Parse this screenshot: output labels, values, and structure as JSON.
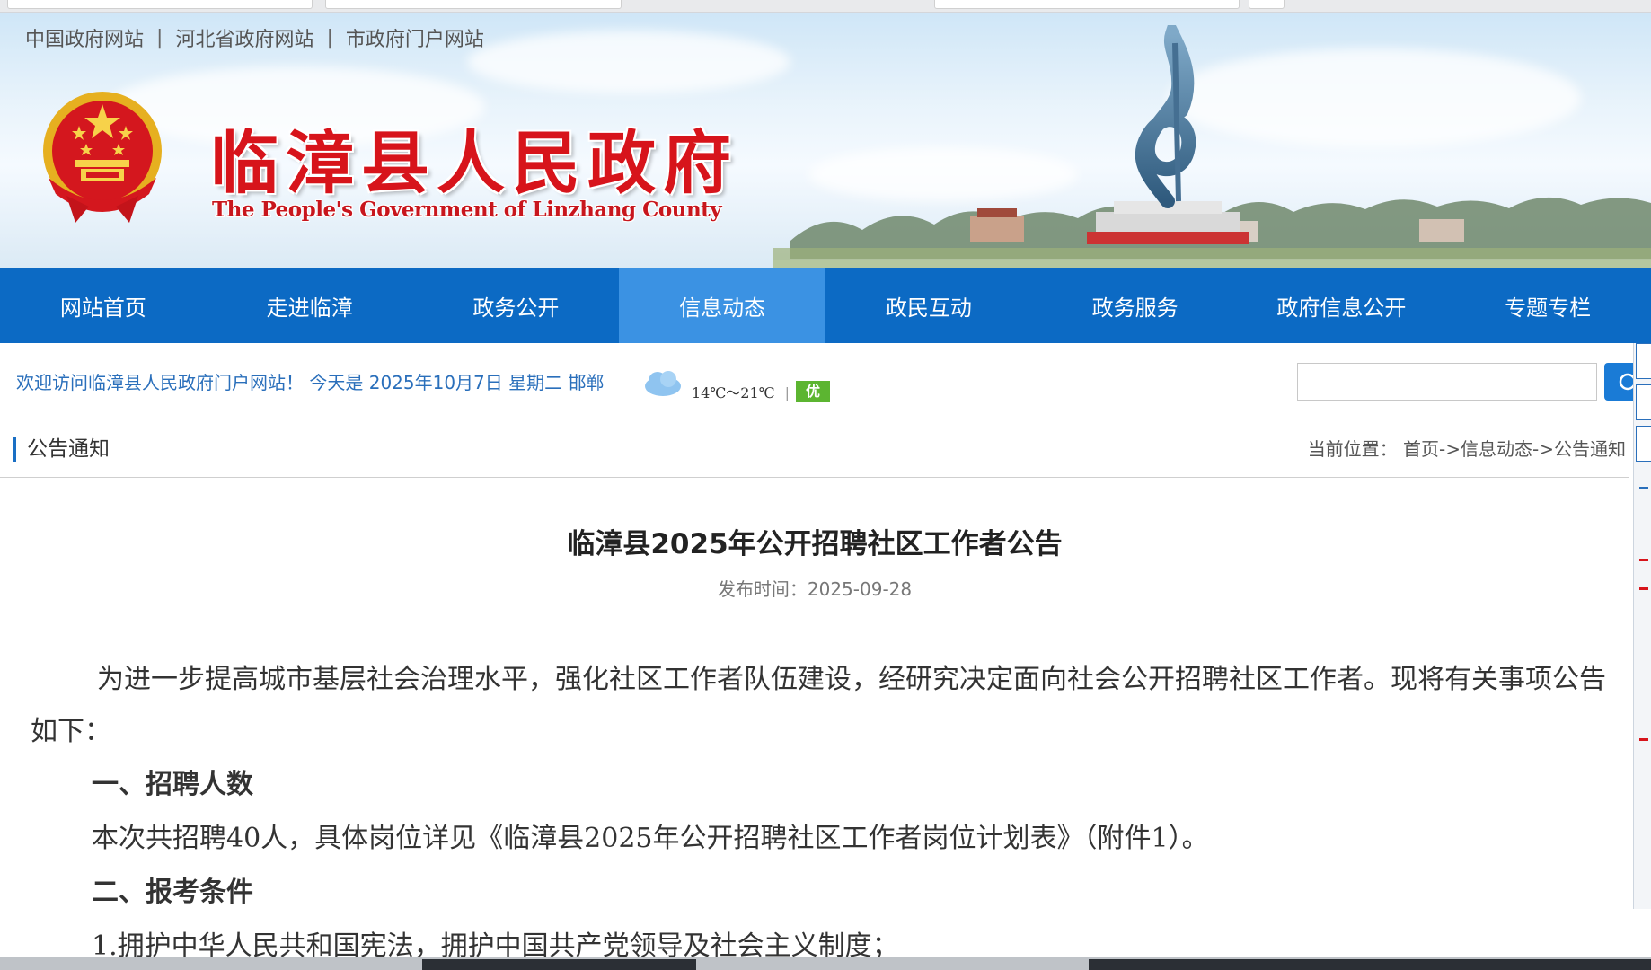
{
  "top_links": [
    "中国政府网站",
    "河北省政府网站",
    "市政府门户网站"
  ],
  "top_links_separator": "|",
  "site": {
    "title_cn": "临漳县人民政府",
    "title_en": "The People's Government of Linzhang County"
  },
  "nav": {
    "items": [
      "网站首页",
      "走进临漳",
      "政务公开",
      "信息动态",
      "政民互动",
      "政务服务",
      "政府信息公开",
      "专题专栏"
    ],
    "active": "信息动态"
  },
  "infobar": {
    "welcome": "欢迎访问临漳县人民政府门户网站！ 今天是 2025年10月7日 星期二 邯郸",
    "weather_icon": "cloud-icon",
    "temperature": "14℃～21℃",
    "separator": "|",
    "air_quality": "优",
    "search_placeholder": ""
  },
  "section": {
    "title": "公告通知",
    "breadcrumb": "当前位置： 首页->信息动态->公告通知"
  },
  "article": {
    "title": "临漳县2025年公开招聘社区工作者公告",
    "publish_label": "发布时间：",
    "publish_date": "2025-09-28",
    "paragraph_intro": "为进一步提高城市基层社会治理水平，强化社区工作者队伍建设，经研究决定面向社会公开招聘社区工作者。现将有关事项公告如下：",
    "heading_1": "一、招聘人数",
    "paragraph_1": "本次共招聘40人，具体岗位详见《临漳县2025年公开招聘社区工作者岗位计划表》（附件1）。",
    "heading_2": "二、报考条件",
    "paragraph_2": "1.拥护中华人民共和国宪法，拥护中国共产党领导及社会主义制度；"
  },
  "colors": {
    "nav_bg": "#0c6ac4",
    "nav_active": "#3b92e3",
    "title_red": "#d7141b",
    "link_blue": "#2a6fbb",
    "aqi_green": "#5cb531"
  }
}
